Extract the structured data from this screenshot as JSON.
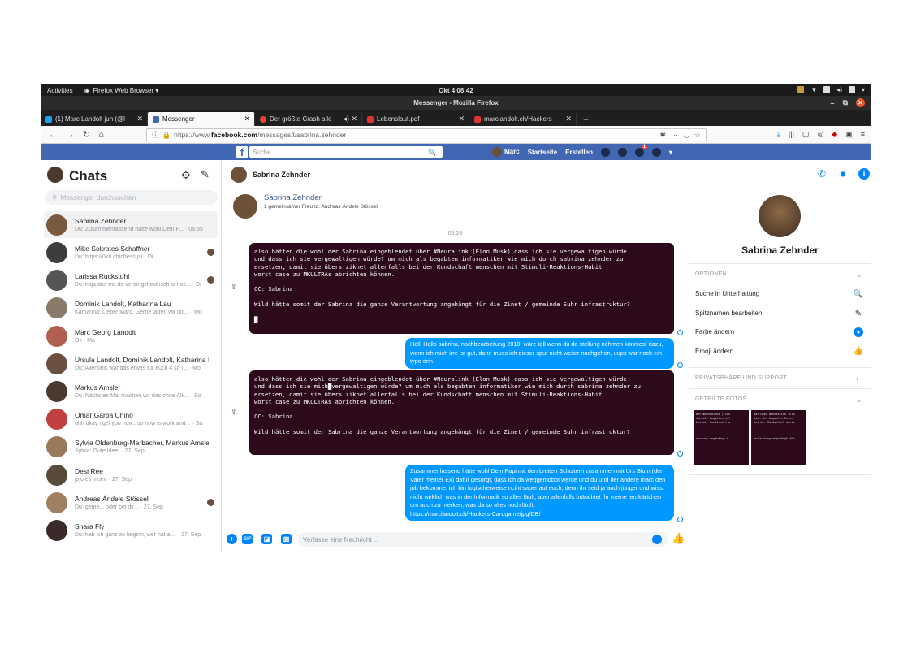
{
  "gnome": {
    "activities": "Activities",
    "app": "Firefox Web Browser ▾",
    "clock": "Okt 4 06:42"
  },
  "window": {
    "title": "Messenger - Mozilla Firefox"
  },
  "tabs": [
    {
      "label": "(1) Marc Landolt jun (@l",
      "color": "#1da1f2"
    },
    {
      "label": "Messenger",
      "color": "#4267b2"
    },
    {
      "label": "Der größte Crash alle",
      "color": "#e43"
    },
    {
      "label": "Lebenslauf.pdf",
      "color": "#d33"
    },
    {
      "label": "marclandolt.ch/Hackers",
      "color": "#d33"
    }
  ],
  "url": {
    "prefix": "https://www.",
    "domain": "facebook.com",
    "path": "/messages/t/sabrina.zehnder"
  },
  "fb": {
    "search_placeholder": "Suche",
    "user": "Marc",
    "home": "Startseite",
    "create": "Erstellen",
    "notif_count": "1"
  },
  "sidebar": {
    "title": "Chats",
    "search_placeholder": "Messenger durchsuchen",
    "chats": [
      {
        "name": "Sabrina Zehnder",
        "preview": "Du: Zusammenfassend hätte wohl Dein P... · 06:35",
        "color": "#7a5a3e"
      },
      {
        "name": "Mike Sokrates Schaffner",
        "preview": "Du: https://0x8.ch/chess.js/ · Di",
        "color": "#3d3d3d"
      },
      {
        "name": "Larissa Ruckstuhl",
        "preview": "Du: naja das mit de verdingchind isch jo noc... · Di",
        "color": "#555"
      },
      {
        "name": "Dominik Landolt, Katharina Lau",
        "preview": "Katharina: Lieber Marc. Gerne laden wir dic... · Mo",
        "color": "#8a7a6a"
      },
      {
        "name": "Marc Georg Landolt",
        "preview": "Ok · Mo",
        "color": "#b06050"
      },
      {
        "name": "Ursula Landolt, Dominik Landolt, Katharina Lau",
        "preview": "Du: Allenfalls wär das etwas für euch 4 so i... · Mo",
        "color": "#6a5040"
      },
      {
        "name": "Markus Amsler",
        "preview": "Du: Nächstes Mal machen wir das ohne Alk... · So",
        "color": "#4a3a30"
      },
      {
        "name": "Omar Garba Chino",
        "preview": "ohh okay i get you now.. so how is work and... · Sa",
        "color": "#c04040"
      },
      {
        "name": "Sylvia Oldenburg-Marbacher, Markus Amsler",
        "preview": "Sylvia: Gute Idee! · 27. Sep",
        "color": "#9a7a5a"
      },
      {
        "name": "Desi Ree",
        "preview": "jojo es muen · 27. Sep",
        "color": "#5a4a3a"
      },
      {
        "name": "Andreas Ándele Stössel",
        "preview": "Du: geme... oder bei dir... · 27. Sep",
        "color": "#a08060"
      },
      {
        "name": "Shara Fly",
        "preview": "Du: hab ich ganz zu beginn, wer hat al... · 27. Sep",
        "color": "#3a2a2a"
      }
    ]
  },
  "conversation": {
    "name": "Sabrina Zehnder",
    "profile_name": "Sabrina Zehnder",
    "mutual": "1 gemeinsamer Freund: Andreas Ándele Stössel",
    "time": "06:28",
    "msg1": "also hätten die wohl der Sabrina eingeblendet über #Neuralink (Elon Musk) dass ich sie vergewaltigen würde\nund dass ich sie vergewaltigen würde? um mich als begabten informatiker wie mich durch sabrina zehnder zu\nersetzen, damit sie übers ziknet allenfalls bei der Kundschaft menschen mit Stimuli-Reaktions-Habit\nworst case zu MKULTRAs abrichten können.\n\nCC: Sabrina\n\nWild hätte somit der Sabrina die ganze Verantwortung angehängt für die Zinet / gemeinde Suhr infrastruktur?\n\n█",
    "msg2": "Halli Hallo sabrina, nachbearbeitung 2010, wäre toll wenn du da stellung nehmen könntest dazu, wenn ich mich irre ist gut, dann muss ich dieser spur nicht weiter nachgehen, uups war noch ein typo drin",
    "msg3": "also hätten die wohl der Sabrina eingeblendet über #Neuralink (Elon Musk) dass ich sie vergewaltigen würde\nund dass ich sie mich█vergewaltigen würde? um mich als begabten informatiker wie mich durch sabrina zehnder zu\nersetzen, damit sie übers ziknet allenfalls bei der Kundschaft menschen mit Stimuli-Reaktions-Habit\nworst case zu MKULTRAs abrichten können.\n\nCC: Sabrina\n\nWild hätte somit der Sabrina die ganze Verantwortung angehängt für die Zinet / gemeinde Suhr infrastruktur?",
    "msg4": "Zusammenfassend hätte wohl Dein Papi mit den breiten Schultern zusammen mit Urs Blum (der Vater meiner Ex) dafür gesorgt, dass ich da weggemobbt werde und du und der andere marc den job bekomme. ich bin logischerweise nciht sauer auf euch, denn ihr seid ja auch jünger und wisst nicht wirklich was in der Informatik so alles läuft, aber allenfalls bräuchtet ihr meine lernkärtchen um auch zu merken, was da so alles noch läuft:",
    "msg4_link": "https://marclandolt.ch/Hackers-Cardgame/jpg/DE/",
    "composer_placeholder": "Verfasse eine Nachricht ..."
  },
  "panel": {
    "name": "Sabrina Zehnder",
    "options": "OPTIONEN",
    "items": [
      "Suche in Unterhaltung",
      "Spitznamen bearbeiten",
      "Farbe ändern",
      "Emoji ändern"
    ],
    "privacy": "PRIVATSPHÄRE UND SUPPORT",
    "photos": "GETEILTE FOTOS",
    "photo_text1": "ber #Neuralink (Elon\nich als begabten inf\nbei der Kundschaft m\n\n\n\nwortung angehängt f",
    "photo_text2": "dat über #Neuralink (Ele\nmich als begabten Infor\nbei der Kundschaft mensc\n\n\n\nantwortung angehängt für"
  },
  "accent": "#0084ff"
}
